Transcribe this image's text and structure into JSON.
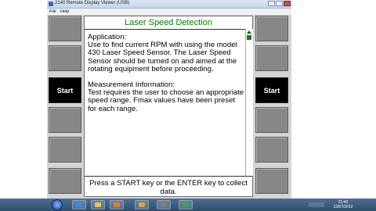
{
  "window": {
    "title": "2140 Remote Display Viewer (USB)",
    "menu": [
      "File",
      "Help"
    ]
  },
  "device": {
    "left_softkeys": [
      "",
      "",
      "Start",
      "",
      "",
      ""
    ],
    "right_softkeys": [
      "",
      "",
      "Start",
      "",
      "",
      ""
    ]
  },
  "screen": {
    "title": "Laser Speed Detection",
    "application_heading": "Application:",
    "application_text": "Use to find current RPM with using the model 430 Laser Speed Sensor. The Laser Speed Sensor should be turned on and aimed at the rotating equipment before proceeding.",
    "measurement_heading": "Measurement Information:",
    "measurement_text": "Test requires the user to choose an appropriate speed range. Fmax values have been preset for each range.",
    "prompt": "Press a START key or the ENTER key to collect data."
  },
  "taskbar": {
    "time": "21:40",
    "date": "13/07/2012"
  },
  "colors": {
    "title_green": "#008000",
    "softkey_gray": "#878787",
    "start_key": "#000000",
    "bezel": "#d4d4d4"
  }
}
